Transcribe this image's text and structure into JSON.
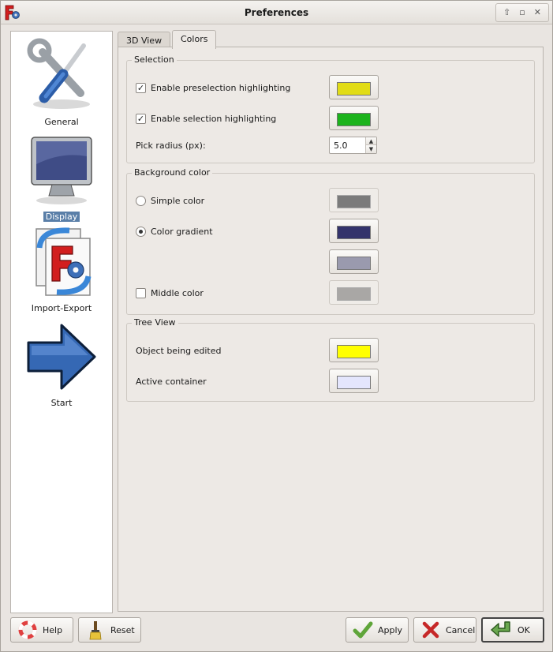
{
  "window": {
    "title": "Preferences"
  },
  "sidebar": {
    "items": [
      {
        "label": "General",
        "icon": "tools-icon",
        "selected": false
      },
      {
        "label": "Display",
        "icon": "monitor-icon",
        "selected": true
      },
      {
        "label": "Import-Export",
        "icon": "import-export-icon",
        "selected": false
      },
      {
        "label": "Start",
        "icon": "arrow-right-icon",
        "selected": false
      }
    ]
  },
  "tabs": [
    {
      "label": "3D View",
      "active": false
    },
    {
      "label": "Colors",
      "active": true
    }
  ],
  "selection": {
    "title": "Selection",
    "preselection_label": "Enable preselection highlighting",
    "preselection_checked": true,
    "preselection_color": "#e1dc16",
    "selection_label": "Enable selection highlighting",
    "selection_checked": true,
    "selection_color": "#1cb31c",
    "pick_radius_label": "Pick radius (px):",
    "pick_radius_value": "5.0"
  },
  "background": {
    "title": "Background color",
    "simple_label": "Simple color",
    "simple_selected": false,
    "simple_color": "#7b7b7b",
    "gradient_label": "Color gradient",
    "gradient_selected": true,
    "gradient_top_color": "#33336b",
    "gradient_bottom_color": "#9a9aae",
    "middle_label": "Middle color",
    "middle_checked": false,
    "middle_color": "#a9a7a5"
  },
  "tree_view": {
    "title": "Tree View",
    "editing_label": "Object being edited",
    "editing_color": "#ffff00",
    "active_label": "Active container",
    "active_color": "#e4e6fd"
  },
  "buttons": {
    "help": "Help",
    "reset": "Reset",
    "apply": "Apply",
    "cancel": "Cancel",
    "ok": "OK"
  }
}
